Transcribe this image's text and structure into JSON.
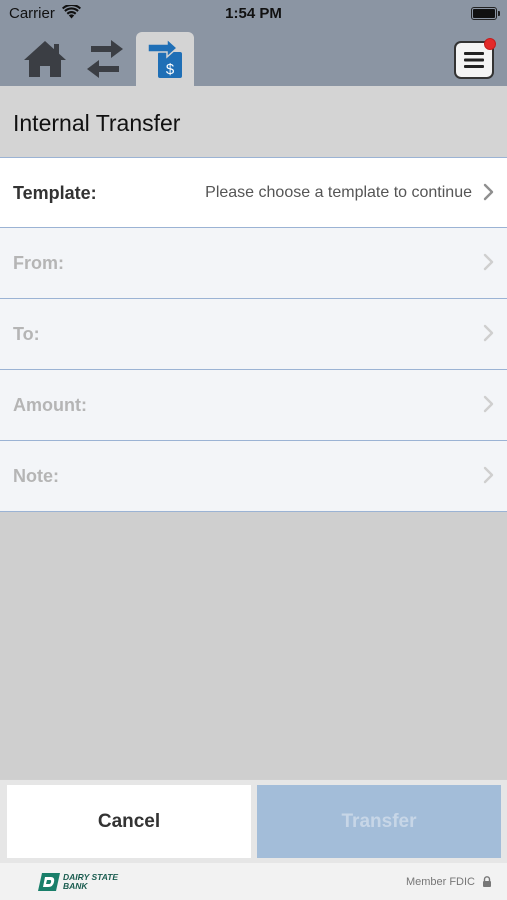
{
  "status_bar": {
    "carrier": "Carrier",
    "time": "1:54 PM"
  },
  "nav": {
    "icons": [
      "home-icon",
      "switch-accounts-icon",
      "transfer-icon",
      "menu-icon"
    ],
    "active": "transfer-icon",
    "notification_color": "#e42a2a"
  },
  "page": {
    "title": "Internal Transfer"
  },
  "form": {
    "rows": [
      {
        "label": "Template:",
        "value": "Please choose a template to continue",
        "enabled": true
      },
      {
        "label": "From:",
        "value": "",
        "enabled": false
      },
      {
        "label": "To:",
        "value": "",
        "enabled": false
      },
      {
        "label": "Amount:",
        "value": "",
        "enabled": false
      },
      {
        "label": "Note:",
        "value": "",
        "enabled": false
      }
    ]
  },
  "actions": {
    "cancel_label": "Cancel",
    "transfer_label": "Transfer"
  },
  "footer": {
    "logo_line1": "DAIRY STATE",
    "logo_line2": "BANK",
    "member_text": "Member FDIC"
  },
  "colors": {
    "nav_bg": "#8b95a3",
    "accent_blue": "#1f6fb6",
    "divider": "#9bb3d4",
    "transfer_disabled_bg": "#a3bdd9",
    "logo_green": "#1a5c4f"
  }
}
